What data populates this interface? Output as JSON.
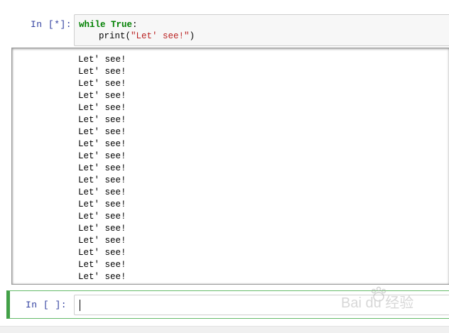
{
  "cell1": {
    "prompt": "In  [*]:",
    "code_line1_keyword1": "while",
    "code_line1_keyword2": "True",
    "code_line1_colon": ":",
    "code_line2_func": "print",
    "code_line2_open": "(",
    "code_line2_string": "\"Let' see!\"",
    "code_line2_close": ")"
  },
  "output": {
    "line_text": "Let' see!",
    "visible_lines": 19,
    "partial_last_line": "Let' see!"
  },
  "cell2": {
    "prompt": "In  [  ]:",
    "input_value": ""
  },
  "watermark": {
    "text": "Bai du 经验",
    "icon": "paw-icon"
  },
  "colors": {
    "prompt": "#303f9f",
    "keyword": "#008000",
    "string": "#ba2121",
    "active_cell_border": "#42a047",
    "input_bg": "#f7f7f7"
  }
}
